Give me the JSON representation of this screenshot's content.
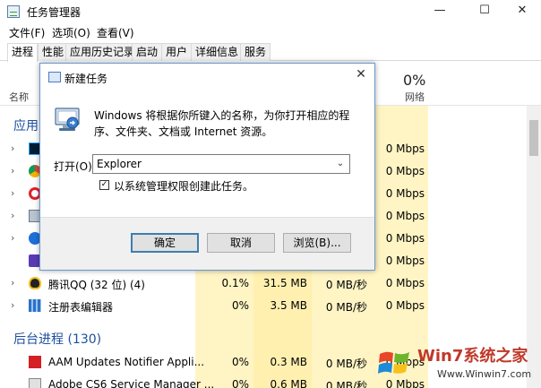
{
  "window": {
    "title": "任务管理器"
  },
  "menubar": [
    "文件(F)",
    "选项(O)",
    "查看(V)"
  ],
  "tabs": [
    "进程",
    "性能",
    "应用历史记录",
    "启动",
    "用户",
    "详细信息",
    "服务"
  ],
  "header": {
    "name_col": "名称",
    "net_pct": "0%",
    "net_col": "网络"
  },
  "sections": {
    "apps": "应用",
    "background": "后台进程 (130)"
  },
  "rows_partial": [
    "0 Mbps",
    "0 Mbps",
    "0 Mbps",
    "0 Mbps",
    "0 Mbps",
    "0 Mbps"
  ],
  "rows": [
    {
      "name": "腾讯QQ (32 位) (4)",
      "cpu": "0.1%",
      "mem": "31.5 MB",
      "disk": "0 MB/秒",
      "net": "0 Mbps"
    },
    {
      "name": "注册表编辑器",
      "cpu": "0%",
      "mem": "3.5 MB",
      "disk": "0 MB/秒",
      "net": "0 Mbps"
    }
  ],
  "bg_rows": [
    {
      "name": "AAM Updates Notifier Appli...",
      "cpu": "0%",
      "mem": "0.3 MB",
      "disk": "0 MB/秒",
      "net": "0 Mbps"
    },
    {
      "name": "Adobe CS6 Service Manager ...",
      "cpu": "0%",
      "mem": "0.6 MB",
      "disk": "0 MB/秒",
      "net": "0 Mbps"
    }
  ],
  "dialog": {
    "title": "新建任务",
    "description": "Windows 将根据你所键入的名称，为你打开相应的程序、文件夹、文档或 Internet 资源。",
    "open_label": "打开(O):",
    "open_value": "Explorer",
    "admin_checkbox": "以系统管理权限创建此任务。",
    "ok": "确定",
    "cancel": "取消",
    "browse": "浏览(B)..."
  },
  "watermark": {
    "brand": "Win7系统之家",
    "url": "Www.Winwin7.com"
  },
  "colors": {
    "accent": "#1c4f9c",
    "highlight": "#fff4c4",
    "dialog_border": "#6a9ad0"
  }
}
